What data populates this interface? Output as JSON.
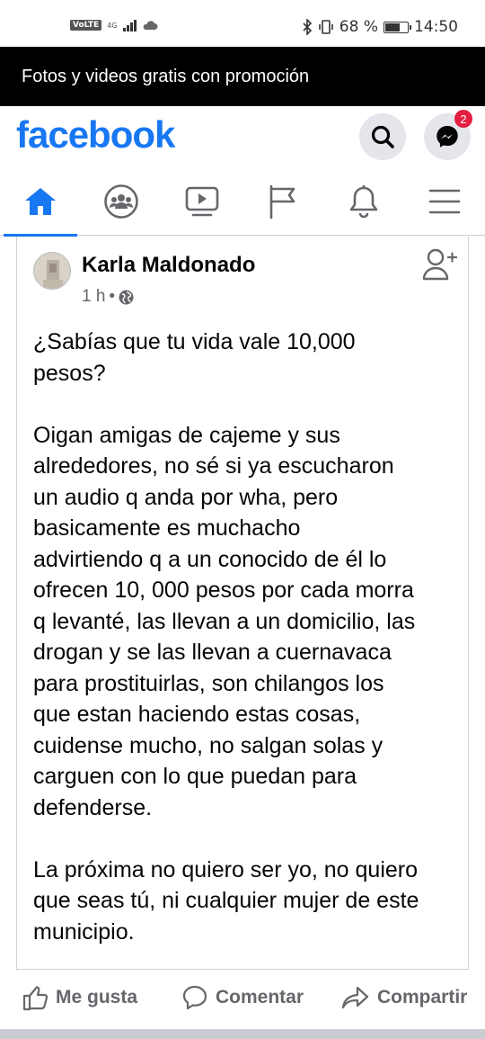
{
  "status_bar": {
    "volte": "VoLTE",
    "network": "4G",
    "battery_percent": "68 %",
    "battery_level": 0.68,
    "time": "14:50"
  },
  "promo_banner": {
    "text": "Fotos y videos gratis con promoción"
  },
  "app_header": {
    "logo": "facebook",
    "messenger_badge": "2",
    "brand_color": "#1877f2"
  },
  "nav": {
    "items": [
      {
        "icon": "home-icon",
        "active": true
      },
      {
        "icon": "groups-icon",
        "active": false
      },
      {
        "icon": "watch-icon",
        "active": false
      },
      {
        "icon": "pages-flag-icon",
        "active": false
      },
      {
        "icon": "notifications-bell-icon",
        "active": false
      },
      {
        "icon": "menu-icon",
        "active": false
      }
    ]
  },
  "post": {
    "author": "Karla Maldonado",
    "time": "1 h",
    "separator": "•",
    "audience_icon": "globe-icon",
    "text": "¿Sabías que tu vida vale 10,000\npesos?\n\nOigan amigas de cajeme y sus\nalrededores, no sé si ya escucharon\nun audio q anda por wha, pero\nbasicamente es muchacho\nadvirtiendo q a un conocido de él lo\nofrecen 10, 000 pesos por cada morra\nq levanté, las llevan a un domicilio, las\ndrogan y se las llevan a cuernavaca\npara prostituirlas, son chilangos los\nque estan haciendo estas cosas,\ncuidense mucho, no salgan solas y\ncarguen con lo que puedan para\ndefenderse.\n\nLa próxima no quiero ser yo, no quiero\nque seas tú, ni cualquier mujer de este\nmunicipio."
  },
  "actions": {
    "like": "Me gusta",
    "comment": "Comentar",
    "share": "Compartir"
  }
}
